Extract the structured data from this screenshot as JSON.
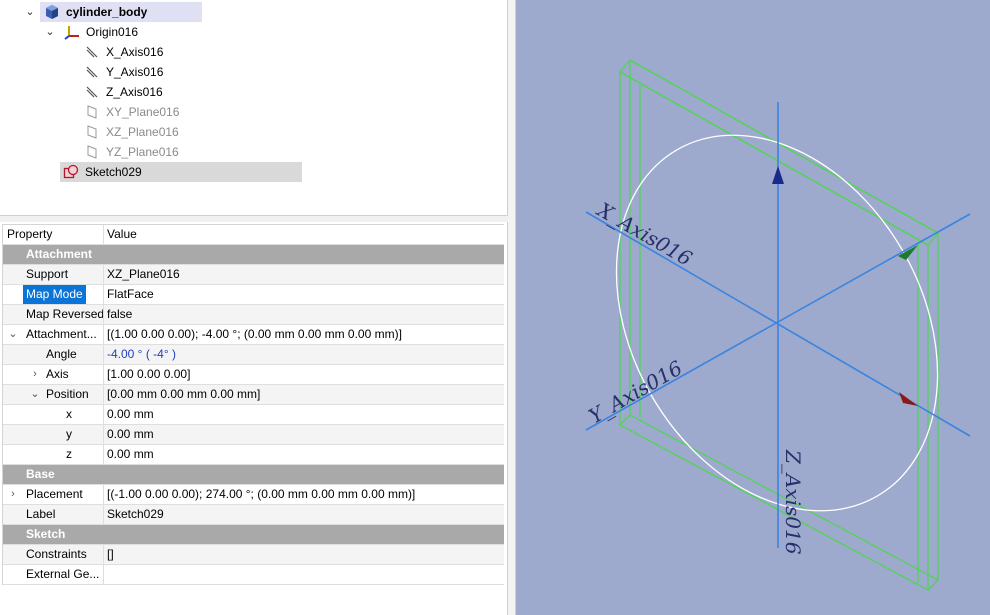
{
  "tree": {
    "items": [
      {
        "label": "cylinder_body",
        "icon": "body-icon"
      },
      {
        "label": "Origin016",
        "icon": "origin-axes-icon"
      },
      {
        "label": "X_Axis016",
        "icon": "axis-icon"
      },
      {
        "label": "Y_Axis016",
        "icon": "axis-icon"
      },
      {
        "label": "Z_Axis016",
        "icon": "axis-icon"
      },
      {
        "label": "XY_Plane016",
        "icon": "plane-icon"
      },
      {
        "label": "XZ_Plane016",
        "icon": "plane-icon"
      },
      {
        "label": "YZ_Plane016",
        "icon": "plane-icon"
      },
      {
        "label": "Sketch029",
        "icon": "sketch-icon"
      }
    ]
  },
  "properties": {
    "header": {
      "property": "Property",
      "value": "Value"
    },
    "rows": [
      {
        "name": "Attachment"
      },
      {
        "name": "Support",
        "value": "XZ_Plane016"
      },
      {
        "name": "Map Mode",
        "value": "FlatFace"
      },
      {
        "name": "Map Reversed",
        "value": "false"
      },
      {
        "name": "Attachment...",
        "value": "[(1.00 0.00 0.00); -4.00 °; (0.00 mm  0.00 mm  0.00 mm)]"
      },
      {
        "name": "Angle",
        "value": "-4.00 °  ( -4° )"
      },
      {
        "name": "Axis",
        "value": "[1.00 0.00 0.00]"
      },
      {
        "name": "Position",
        "value": "[0.00 mm  0.00 mm  0.00 mm]"
      },
      {
        "name": "x",
        "value": "0.00 mm"
      },
      {
        "name": "y",
        "value": "0.00 mm"
      },
      {
        "name": "z",
        "value": "0.00 mm"
      },
      {
        "name": "Base"
      },
      {
        "name": "Placement",
        "value": "[(-1.00 0.00 0.00); 274.00 °; (0.00 mm  0.00 mm  0.00 mm)]"
      },
      {
        "name": "Label",
        "value": "Sketch029"
      },
      {
        "name": "Sketch"
      },
      {
        "name": "Constraints",
        "value": "[]"
      },
      {
        "name": "External Ge...",
        "value": ""
      }
    ]
  },
  "viewport": {
    "background": "#9da9cd",
    "axis_color": "#3a84e0",
    "box_color": "#4cd84c",
    "circle_color": "#ffffff",
    "labels": {
      "x_axis": "X_Axis016",
      "y_axis": "Y_Axis016",
      "z_axis": "Z_Axis016"
    },
    "arrow_colors": {
      "z": "#1a2a8a",
      "y": "#1f7a2a",
      "x": "#8a1a1a"
    }
  }
}
